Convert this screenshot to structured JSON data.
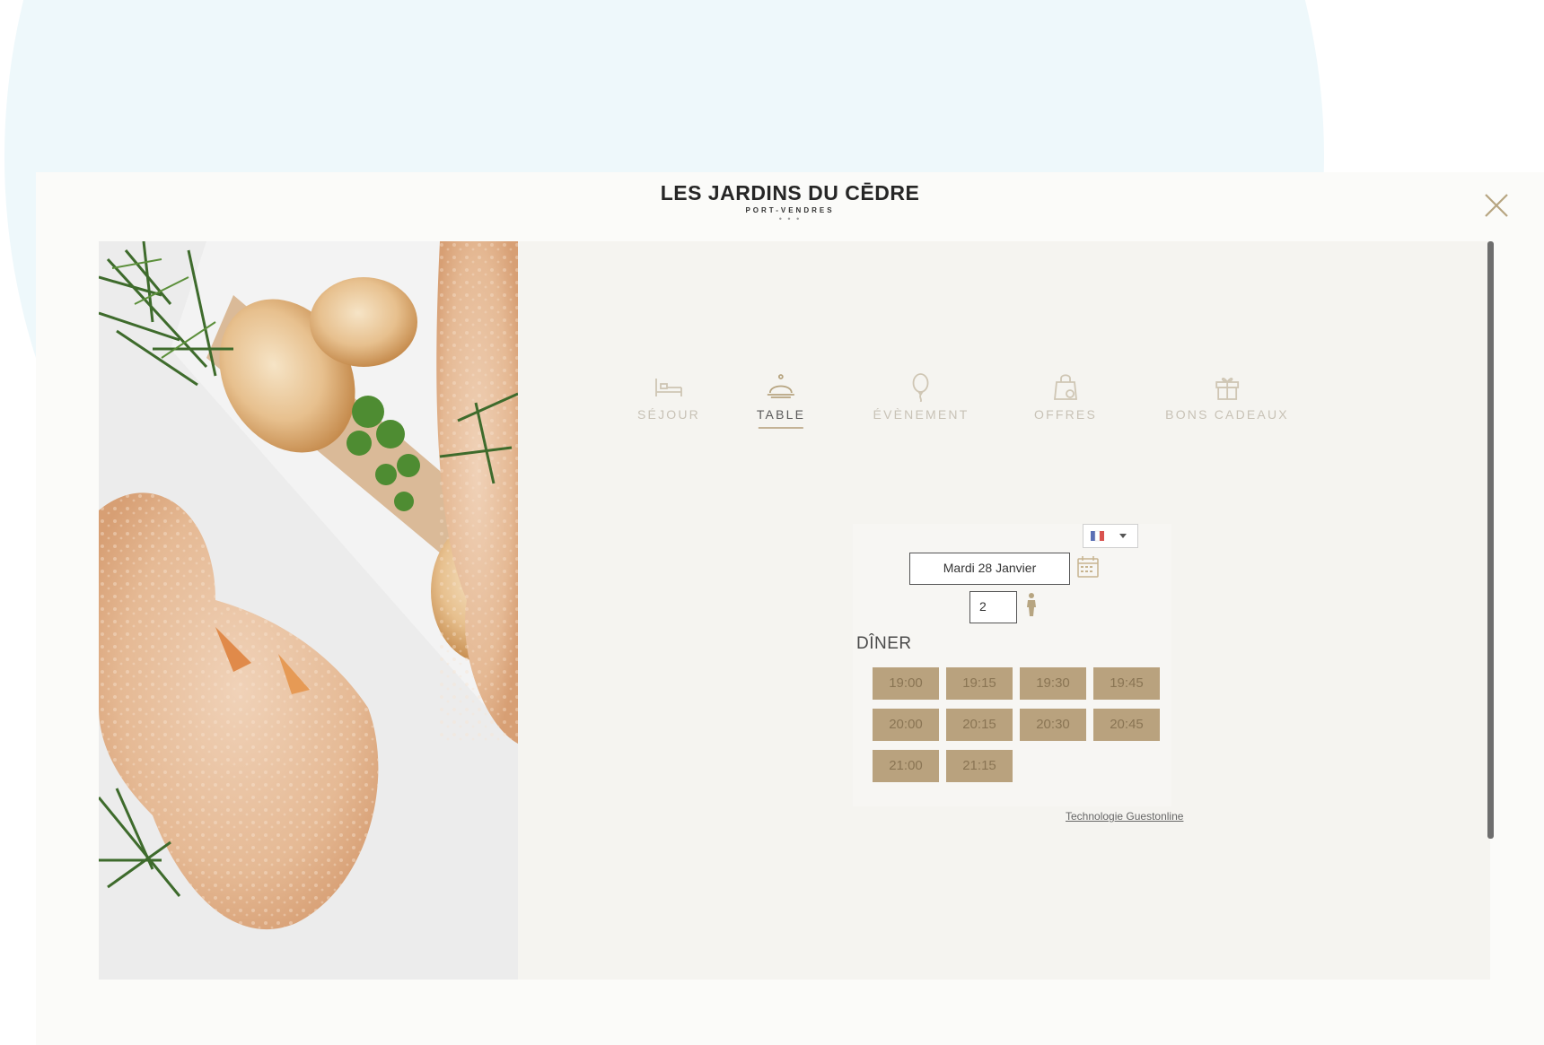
{
  "brand": {
    "name": "LES JARDINS DU CĒDRE",
    "location": "PORT-VENDRES",
    "dots": "• • •"
  },
  "nav": {
    "items": [
      {
        "label": "SÉJOUR",
        "icon": "bed-icon"
      },
      {
        "label": "TABLE",
        "icon": "cloche-icon",
        "active": true
      },
      {
        "label": "ÉVÈNEMENT",
        "icon": "balloon-icon"
      },
      {
        "label": "OFFRES",
        "icon": "shopping-bag-icon"
      },
      {
        "label": "BONS CADEAUX",
        "icon": "gift-icon"
      }
    ]
  },
  "booking": {
    "language_flag": "fr-flag-icon",
    "date_value": "Mardi 28 Janvier",
    "guests_value": "2",
    "section_title": "DÎNER",
    "time_slots": [
      "19:00",
      "19:15",
      "19:30",
      "19:45",
      "20:00",
      "20:15",
      "20:30",
      "20:45",
      "21:00",
      "21:15"
    ]
  },
  "footer": {
    "powered_by": "Technologie Guestonline"
  },
  "colors": {
    "accent": "#b9a27e",
    "panel_bg": "#f5f4f0",
    "nav_inactive": "#c8c2b6"
  }
}
